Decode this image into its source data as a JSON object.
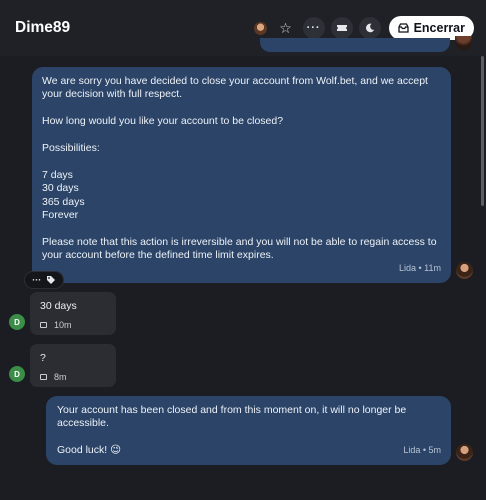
{
  "header": {
    "title": "Dime89",
    "close_label": "Encerrar",
    "more_icon": "ellipsis-icon",
    "star_icon": "star-icon",
    "ticket_icon": "ticket-icon",
    "moon_icon": "moon-icon"
  },
  "messages": [
    {
      "author": "agent",
      "text": "We are sorry you have decided to close your account from Wolf.bet, and we accept your decision with full respect.\n\nHow long would you like your account to be closed?\n\nPossibilities:\n\n7 days\n30 days\n365 days\nForever\n\nPlease note that this action is irreversible and you will not be able to regain access to your account before the defined time limit expires.",
      "meta": "Lida • 11m"
    },
    {
      "author": "user",
      "avatar_letter": "D",
      "text": "30 days",
      "time": "10m"
    },
    {
      "author": "user",
      "avatar_letter": "D",
      "text": "?",
      "time": "8m"
    },
    {
      "author": "agent",
      "text": "Your account has been closed and from this moment on, it will no longer be accessible.\n\nGood luck! 😉",
      "meta": "Lida • 5m"
    }
  ],
  "context_menu": {
    "more_label": "···",
    "tag_icon": "tag-icon"
  },
  "colors": {
    "agent_bubble": "#2b4467",
    "user_bubble": "#2b2d32",
    "user_avatar": "#3c8d48",
    "background": "#1b1d22"
  }
}
